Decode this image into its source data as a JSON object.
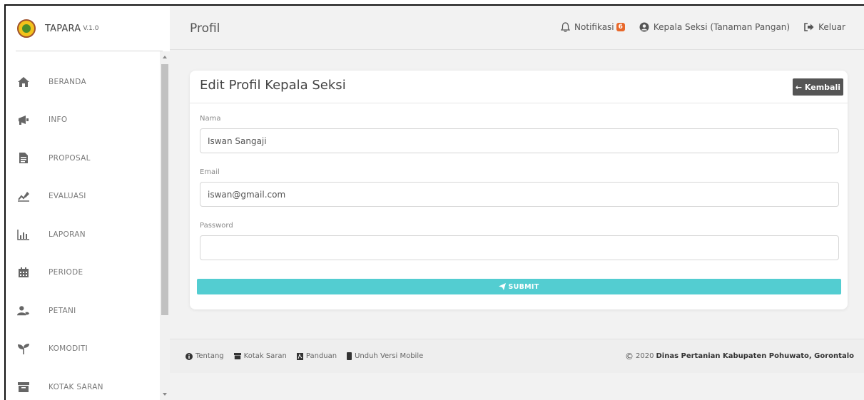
{
  "brand": {
    "name": "TAPARA",
    "version": "V.1.0"
  },
  "sidebar": {
    "items": [
      {
        "label": "BERANDA",
        "icon": "home-icon"
      },
      {
        "label": "INFO",
        "icon": "megaphone-icon"
      },
      {
        "label": "PROPOSAL",
        "icon": "document-icon"
      },
      {
        "label": "EVALUASI",
        "icon": "chart-pen-icon"
      },
      {
        "label": "LAPORAN",
        "icon": "bar-chart-icon"
      },
      {
        "label": "PERIODE",
        "icon": "calendar-icon"
      },
      {
        "label": "PETANI",
        "icon": "user-tag-icon"
      },
      {
        "label": "KOMODITI",
        "icon": "seedling-icon"
      },
      {
        "label": "KOTAK SARAN",
        "icon": "box-icon"
      }
    ]
  },
  "topbar": {
    "title": "Profil",
    "notifications_label": "Notifikasi",
    "notifications_count": "6",
    "user_label": "Kepala Seksi (Tanaman Pangan)",
    "logout_label": "Keluar"
  },
  "form": {
    "title": "Edit Profil Kepala Seksi",
    "back_label": "← Kembali",
    "name_label": "Nama",
    "name_value": "Iswan Sangaji",
    "email_label": "Email",
    "email_value": "iswan@gmail.com",
    "password_label": "Password",
    "password_value": "",
    "submit_label": "SUBMIT"
  },
  "footer": {
    "links": [
      {
        "label": "Tentang",
        "icon": "info-circle-icon"
      },
      {
        "label": "Kotak Saran",
        "icon": "inbox-icon"
      },
      {
        "label": "Panduan",
        "icon": "pdf-icon"
      },
      {
        "label": "Unduh Versi Mobile",
        "icon": "mobile-icon"
      }
    ],
    "copyright_year": "2020",
    "copyright_org": "Dinas Pertanian Kabupaten Pohuwato, Gorontalo"
  },
  "colors": {
    "accent": "#53cdd1",
    "badge": "#e8682a",
    "back_button": "#555555"
  }
}
